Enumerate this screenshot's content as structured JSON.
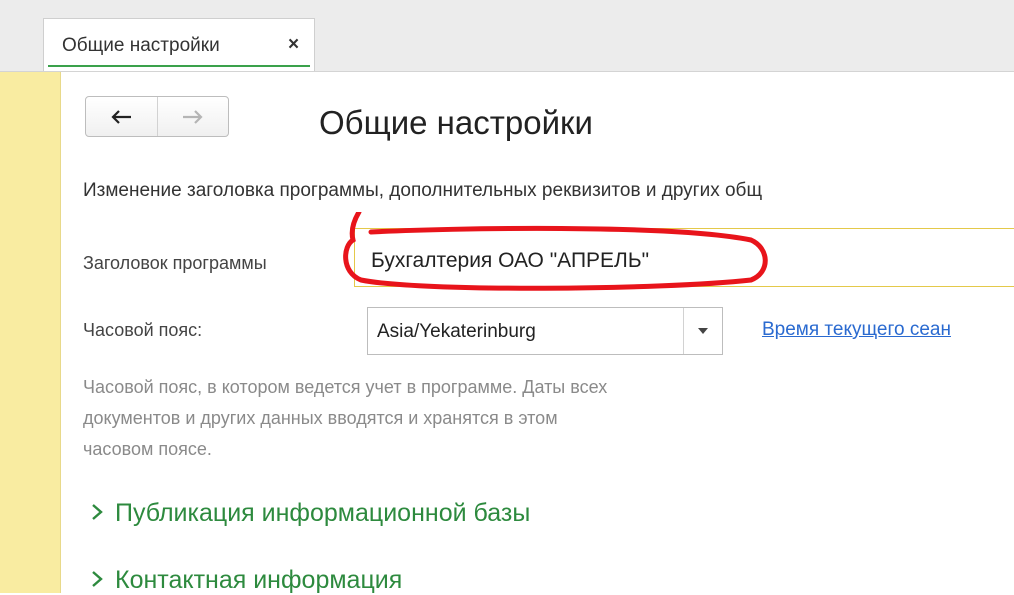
{
  "tab": {
    "label": "Общие настройки",
    "close_glyph": "×",
    "active_color": "#3aa14b"
  },
  "page": {
    "title": "Общие настройки",
    "description": "Изменение заголовка программы, дополнительных реквизитов и других общ"
  },
  "program_title": {
    "label": "Заголовок программы",
    "value": "Бухгалтерия ОАО \"АПРЕЛЬ\""
  },
  "timezone": {
    "label": "Часовой пояс:",
    "value": "Asia/Yekaterinburg",
    "link": "Время текущего сеан",
    "note_lines": [
      "Часовой пояс, в котором ведется учет в программе. Даты всех",
      "документов и других данных вводятся и хранятся в этом",
      "часовом поясе."
    ]
  },
  "sections": [
    {
      "label": "Публикация информационной базы",
      "icon": "chevron-right-icon"
    },
    {
      "label": "Контактная информация",
      "icon": "chevron-right-icon"
    }
  ],
  "icons": {
    "back": "arrow-left-icon",
    "forward": "arrow-right-icon",
    "dropdown": "chevron-down-icon"
  },
  "colors": {
    "sidebar": "#f9eca1",
    "link": "#2a6ad0",
    "section": "#2d8a3e",
    "annotation": "#e8141b"
  }
}
